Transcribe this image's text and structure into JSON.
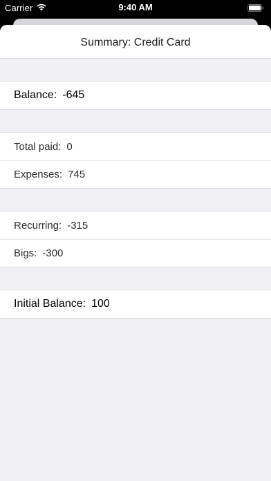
{
  "status_bar": {
    "carrier": "Carrier",
    "time": "9:40 AM",
    "icons": [
      "wifi-icon",
      "battery-icon"
    ]
  },
  "navigation": {
    "title": "Summary: Credit Card"
  },
  "summary": {
    "balance": {
      "label": "Balance:",
      "value": "-645"
    },
    "total_paid": {
      "label": "Total paid:",
      "value": "0"
    },
    "expenses": {
      "label": "Expenses:",
      "value": "745"
    },
    "recurring": {
      "label": "Recurring:",
      "value": "-315"
    },
    "bigs": {
      "label": "Bigs:",
      "value": "-300"
    },
    "initial_balance": {
      "label": "Initial Balance:",
      "value": "100"
    }
  },
  "colors": {
    "background": "#efeff4",
    "cell": "#ffffff",
    "separator": "#dcdce0",
    "text": "#000000"
  }
}
